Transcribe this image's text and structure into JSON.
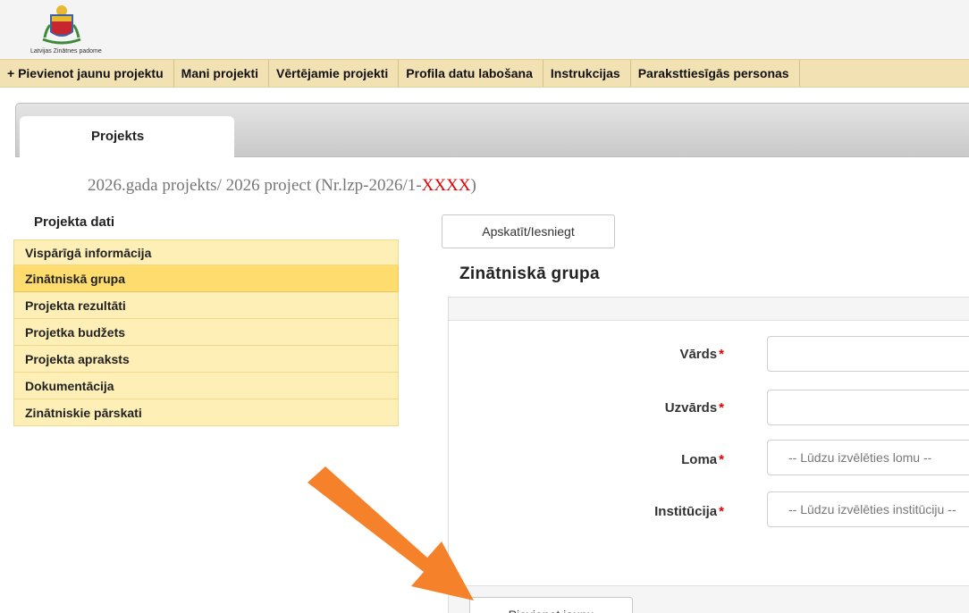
{
  "org": {
    "name": "Latvijas Zinātnes padome"
  },
  "nav": {
    "items": [
      "+ Pievienot jaunu projektu",
      "Mani projekti",
      "Vērtējamie projekti",
      "Profila datu labošana",
      "Instrukcijas",
      "Paraksttiesīgās personas"
    ]
  },
  "tabs": {
    "active": "Projekts"
  },
  "project": {
    "title_prefix": "2026.gada projekts/ 2026 project (Nr.lzp-2026/1-",
    "title_code": "XXXX",
    "title_suffix": ")"
  },
  "sidebar": {
    "title": "Projekta dati",
    "items": [
      {
        "label": "Vispārīgā informācija"
      },
      {
        "label": "Zinātniskā grupa"
      },
      {
        "label": "Projekta rezultāti"
      },
      {
        "label": "Projetka budžets"
      },
      {
        "label": "Projekta apraksts"
      },
      {
        "label": "Dokumentācija"
      },
      {
        "label": "Zinātniskie pārskati"
      }
    ],
    "active_index": 1
  },
  "main": {
    "view_button": "Apskatīt/Iesniegt",
    "section_title": "Zinātniskā grupa",
    "required_mark": "*",
    "form": {
      "first_name": {
        "label": "Vārds",
        "value": ""
      },
      "last_name": {
        "label": "Uzvārds",
        "value": ""
      },
      "role": {
        "label": "Loma",
        "selected": "-- Lūdzu izvēlēties lomu --"
      },
      "institution": {
        "label": "Institūcija",
        "selected": "-- Lūdzu izvēlēties institūciju --"
      }
    },
    "add_button": "Pievienot jaunu"
  },
  "annotation": {
    "arrow_color": "#f5822a"
  },
  "colors": {
    "nav_bg": "#f2e1b2",
    "side_item": "#fdefb6",
    "side_active": "#fedd6e",
    "required": "#e00000"
  }
}
